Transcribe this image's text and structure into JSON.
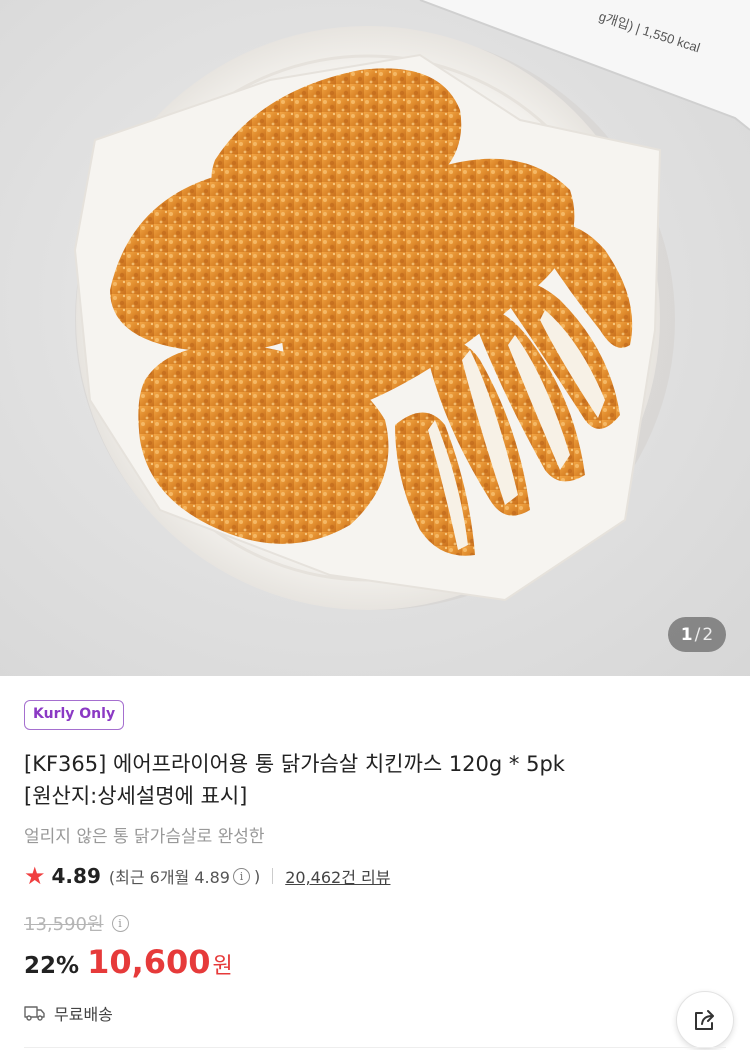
{
  "product_image": {
    "package_text": "g개입) | 1,550 kcal",
    "page_current": "1",
    "page_separator": "/",
    "page_total": "2"
  },
  "badge": "Kurly Only",
  "title_line1": "[KF365] 에어프라이어용 통 닭가슴살 치킨까스 120g * 5pk",
  "title_line2": "[원산지:상세설명에 표시]",
  "subtitle": "얼리지 않은 통 닭가슴살로 완성한",
  "rating": {
    "star": "★",
    "score": "4.89",
    "recent_prefix": "(최근 6개월 4.89",
    "recent_suffix": ")",
    "info_icon": "i",
    "reviews": "20,462건 리뷰"
  },
  "price": {
    "original": "13,590원",
    "discount": "22%",
    "current": "10,600",
    "currency": "원"
  },
  "delivery": "무료배송",
  "colors": {
    "accent": "#8b39c4",
    "sale": "#e63a3a",
    "star": "#f03f40"
  }
}
